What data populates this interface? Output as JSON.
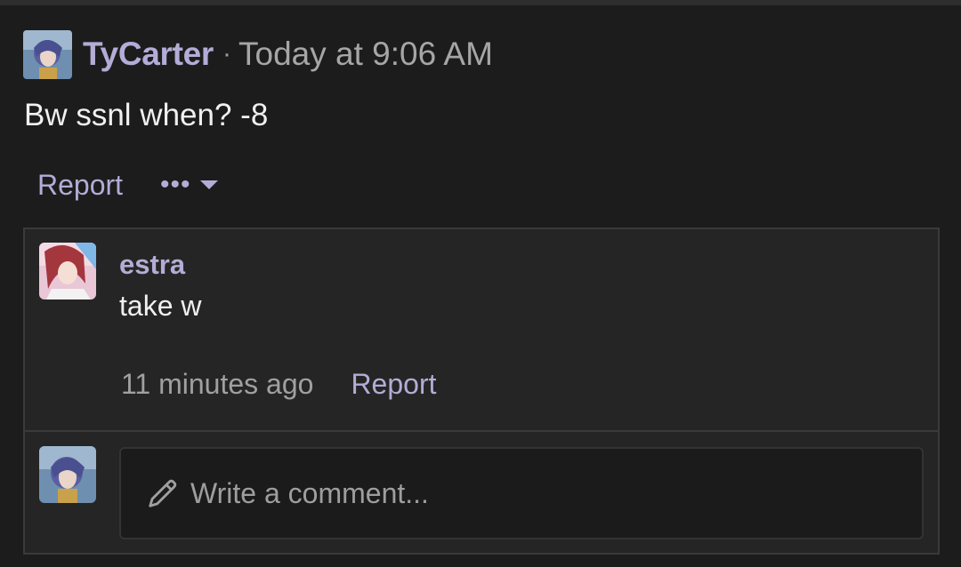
{
  "post": {
    "author": "TyCarter",
    "separator": "·",
    "timestamp": "Today at 9:06 AM",
    "body": "Bw ssnl when? -8",
    "report_label": "Report",
    "more_label": "•••"
  },
  "comments": [
    {
      "author": "estra",
      "text": "take w",
      "time": "11 minutes ago",
      "report_label": "Report"
    }
  ],
  "composer": {
    "placeholder": "Write a comment..."
  },
  "icons": {
    "more": "more-dots-icon",
    "caret": "caret-down-icon",
    "pencil": "pencil-icon"
  },
  "colors": {
    "accent": "#b3acd6",
    "background": "#1c1c1c",
    "panel": "#252525"
  }
}
